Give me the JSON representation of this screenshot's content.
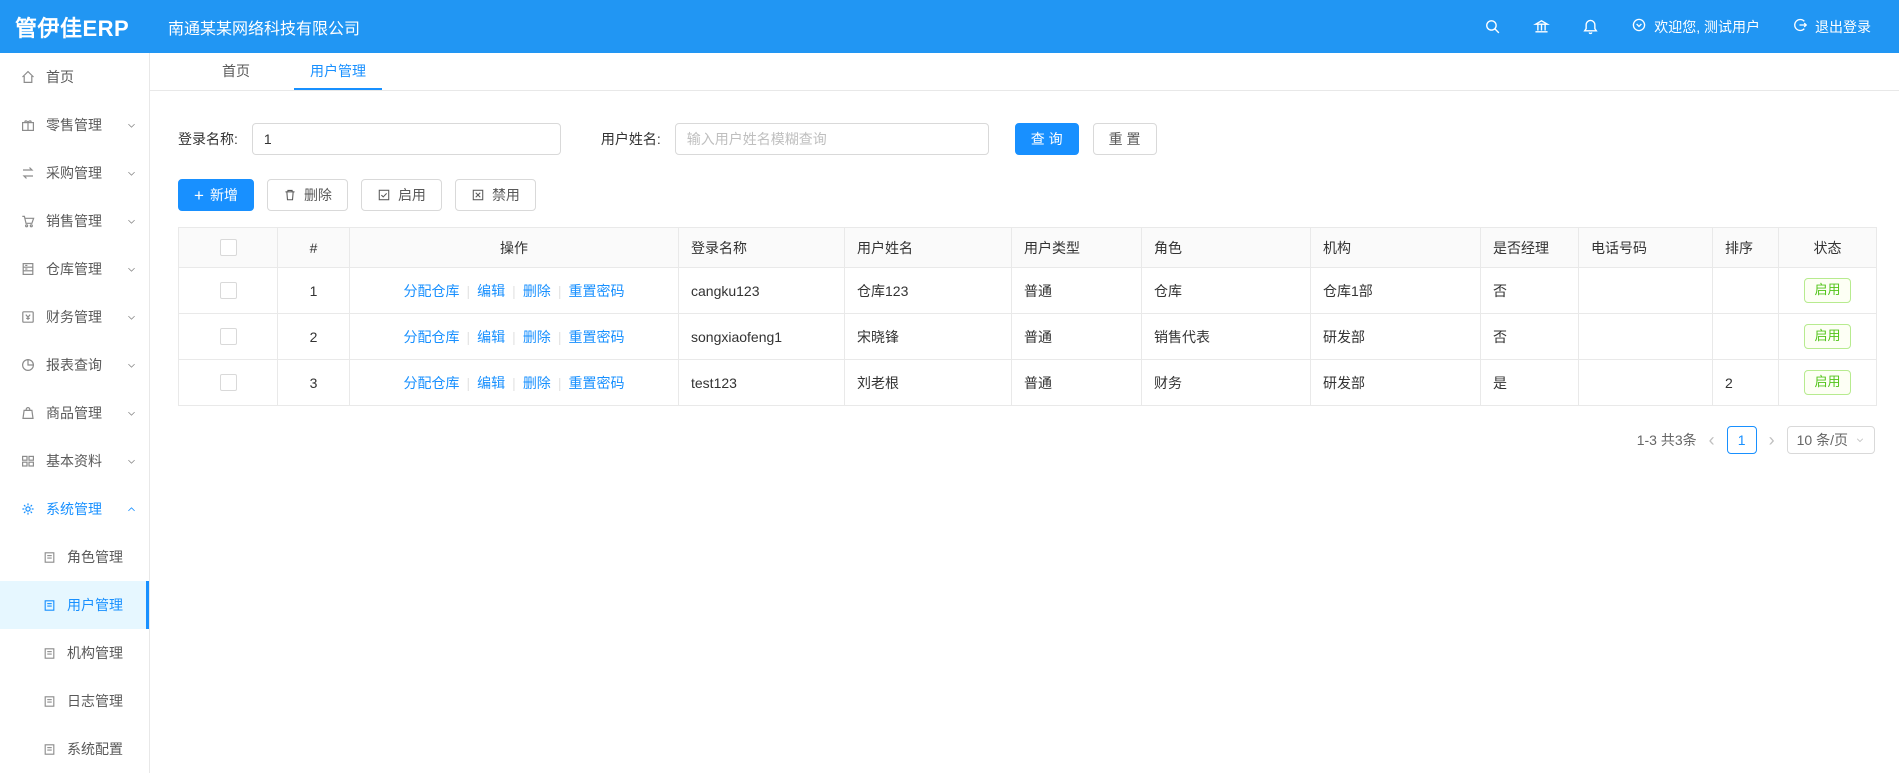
{
  "colors": {
    "header_bg": "#2196f3",
    "primary": "#1890ff",
    "success": "#52c41a",
    "active_menu_bg": "#e6f7ff"
  },
  "header": {
    "logo": "管伊佳ERP",
    "company": "南通某某网络科技有限公司",
    "icons": [
      "search-icon",
      "bank-icon",
      "bell-icon",
      "user-circle-icon",
      "logout-icon"
    ],
    "welcome": "欢迎您, 测试用户",
    "logout": "退出登录"
  },
  "sidebar": {
    "items": [
      {
        "label": "首页",
        "icon": "home-icon"
      },
      {
        "label": "零售管理",
        "icon": "retail-icon"
      },
      {
        "label": "采购管理",
        "icon": "purchase-icon"
      },
      {
        "label": "销售管理",
        "icon": "sales-cart-icon"
      },
      {
        "label": "仓库管理",
        "icon": "warehouse-icon"
      },
      {
        "label": "财务管理",
        "icon": "finance-icon"
      },
      {
        "label": "报表查询",
        "icon": "report-pie-icon"
      },
      {
        "label": "商品管理",
        "icon": "goods-bag-icon"
      },
      {
        "label": "基本资料",
        "icon": "basic-grid-icon"
      },
      {
        "label": "系统管理",
        "icon": "gear-icon",
        "expanded": true,
        "children": [
          "角色管理",
          "用户管理",
          "机构管理",
          "日志管理",
          "系统配置"
        ],
        "active_child": "用户管理"
      }
    ]
  },
  "tabs": [
    {
      "label": "首页",
      "active": false
    },
    {
      "label": "用户管理",
      "active": true
    }
  ],
  "search": {
    "login_label": "登录名称:",
    "login_value": "1",
    "name_label": "用户姓名:",
    "name_placeholder": "输入用户姓名模糊查询",
    "query_btn": "查 询",
    "reset_btn": "重 置"
  },
  "toolbar": {
    "add": "新增",
    "delete": "删除",
    "enable": "启用",
    "disable": "禁用"
  },
  "table": {
    "headers": [
      "#",
      "操作",
      "登录名称",
      "用户姓名",
      "用户类型",
      "角色",
      "机构",
      "是否经理",
      "电话号码",
      "排序",
      "状态"
    ],
    "ops": [
      "分配仓库",
      "编辑",
      "删除",
      "重置密码"
    ],
    "rows": [
      {
        "index": "1",
        "login": "cangku123",
        "name": "仓库123",
        "type": "普通",
        "role": "仓库",
        "org": "仓库1部",
        "manager": "否",
        "phone": "",
        "sort": "",
        "status": "启用"
      },
      {
        "index": "2",
        "login": "songxiaofeng1",
        "name": "宋晓锋",
        "type": "普通",
        "role": "销售代表",
        "org": "研发部",
        "manager": "否",
        "phone": "",
        "sort": "",
        "status": "启用"
      },
      {
        "index": "3",
        "login": "test123",
        "name": "刘老根",
        "type": "普通",
        "role": "财务",
        "org": "研发部",
        "manager": "是",
        "phone": "",
        "sort": "2",
        "status": "启用"
      }
    ]
  },
  "pagination": {
    "total": "1-3 共3条",
    "prev": "‹",
    "page": "1",
    "next": "›",
    "page_size": "10 条/页"
  }
}
